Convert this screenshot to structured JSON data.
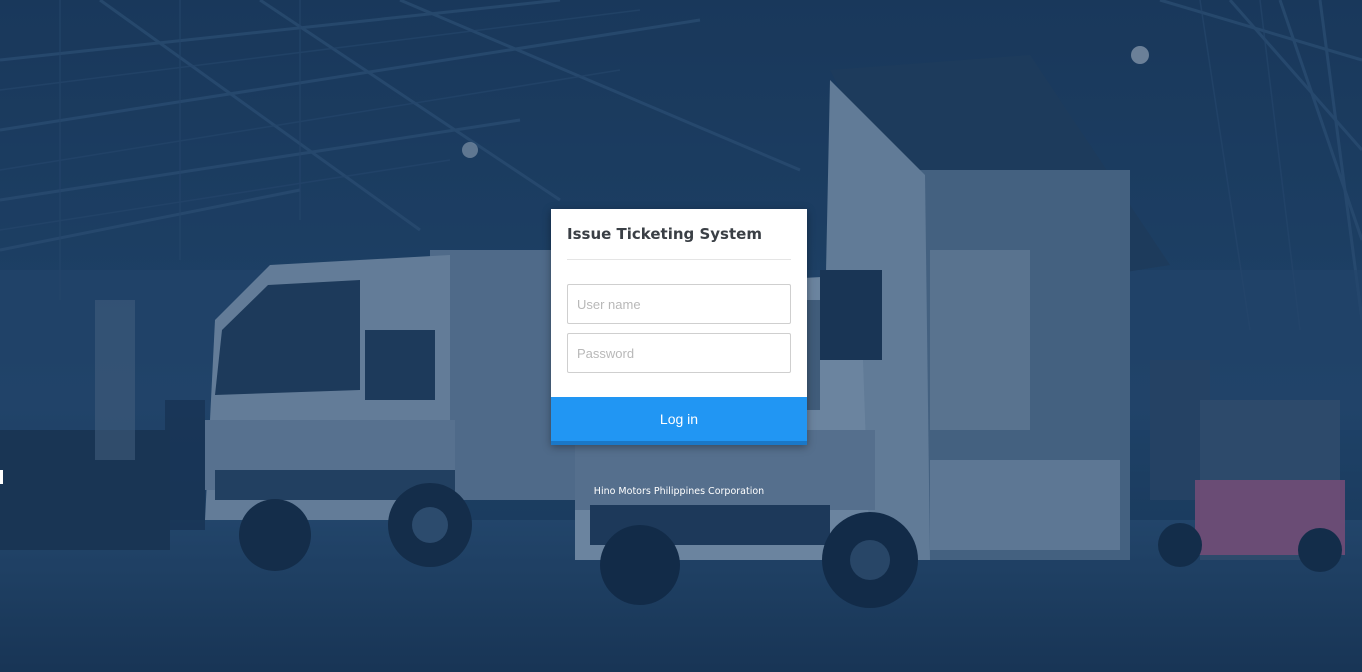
{
  "login": {
    "title": "Issue Ticketing System",
    "username_placeholder": "User name",
    "password_placeholder": "Password",
    "login_label": "Log in"
  },
  "footer": {
    "company": "Hino Motors Philippines Corporation"
  },
  "colors": {
    "overlay": "#1b3a5c",
    "button": "#2196f3",
    "card": "#ffffff"
  }
}
